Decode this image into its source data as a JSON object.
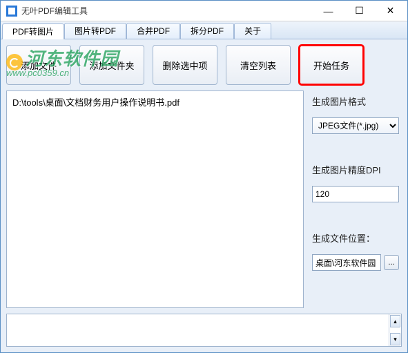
{
  "window": {
    "title": "无叶PDF编辑工具"
  },
  "win_controls": {
    "min": "—",
    "max": "☐",
    "close": "✕"
  },
  "tabs": [
    {
      "label": "PDF转图片",
      "active": true
    },
    {
      "label": "图片转PDF",
      "active": false
    },
    {
      "label": "合并PDF",
      "active": false
    },
    {
      "label": "拆分PDF",
      "active": false
    },
    {
      "label": "关于",
      "active": false
    }
  ],
  "actions": {
    "add_file": "添加文件",
    "add_folder": "添加文件夹",
    "delete_selected": "删除选中项",
    "clear_list": "清空列表",
    "start_task": "开始任务"
  },
  "file_list": [
    "D:\\tools\\桌面\\文档财务用户操作说明书.pdf"
  ],
  "options": {
    "format_label": "生成图片格式",
    "format_value": "JPEG文件(*.jpg)",
    "dpi_label": "生成图片精度DPI",
    "dpi_value": "120",
    "location_label": "生成文件位置：",
    "location_value": "桌面\\河东软件园",
    "browse_label": "..."
  },
  "scroll": {
    "up": "▴",
    "down": "▾"
  },
  "watermark": {
    "text": "河东软件园",
    "url": "www.pc0359.cn"
  }
}
